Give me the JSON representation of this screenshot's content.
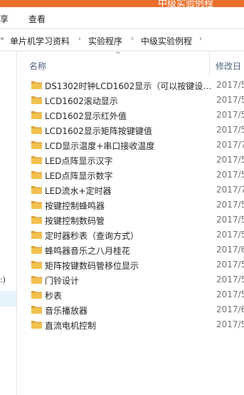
{
  "window": {
    "title": "中级实验例程"
  },
  "ribbon": {
    "tabs": [
      "享",
      "查看"
    ]
  },
  "address": {
    "back_chevron": "«",
    "crumbs": [
      "单片机学习资料",
      "实验程序",
      "中级实验例程"
    ]
  },
  "nav": {
    "partial_label": ":)"
  },
  "columns": {
    "name": "名称",
    "date": "修改日"
  },
  "files": [
    {
      "name": "DS1302时钟LCD1602显示（可以按键设…",
      "date": "2017/5"
    },
    {
      "name": "LCD1602滚动显示",
      "date": "2017/5"
    },
    {
      "name": "LCD1602显示红外值",
      "date": "2017/5"
    },
    {
      "name": "LCD1602显示矩阵按键键值",
      "date": "2017/5"
    },
    {
      "name": "LCD显示温度+串口接收温度",
      "date": "2017/7"
    },
    {
      "name": "LED点阵显示汉字",
      "date": "2017/5"
    },
    {
      "name": "LED点阵显示数字",
      "date": "2017/5"
    },
    {
      "name": "LED流水+定时器",
      "date": "2017/7"
    },
    {
      "name": "按键控制蜂鸣器",
      "date": "2017/5"
    },
    {
      "name": "按键控制数码管",
      "date": "2017/5"
    },
    {
      "name": "定时器秒表（查询方式）",
      "date": "2017/5"
    },
    {
      "name": "蜂鸣器音乐之八月桂花",
      "date": "2017/6"
    },
    {
      "name": "矩阵按键数码管移位显示",
      "date": "2017/5"
    },
    {
      "name": "门铃设计",
      "date": "2017/5"
    },
    {
      "name": "秒表",
      "date": "2017/5"
    },
    {
      "name": "音乐播放器",
      "date": "2017/6"
    },
    {
      "name": "直流电机控制",
      "date": "2017/5"
    }
  ],
  "colors": {
    "folder": "#f2c14e",
    "folder_dark": "#d9a43a",
    "titlebar": "#e8702a",
    "header_text": "#4c607a"
  }
}
